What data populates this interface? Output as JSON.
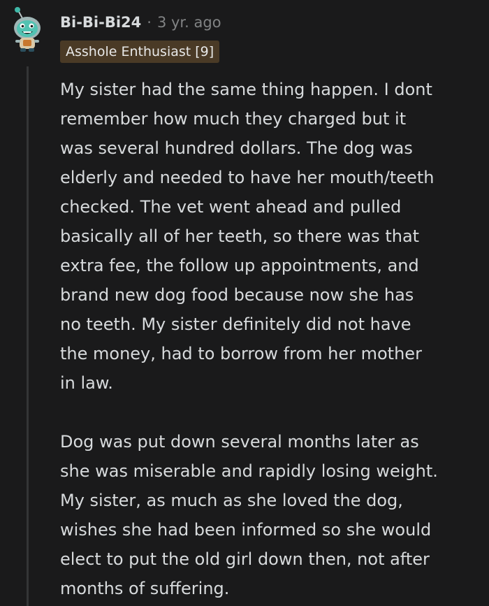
{
  "comment": {
    "author": "Bi-Bi-Bi24",
    "separator": "·",
    "timestamp": "3 yr. ago",
    "flair": "Asshole Enthusiast [9]",
    "avatar_icon": "snoo-avatar-icon",
    "paragraphs": [
      [
        "My sister had the same thing happen. I dont",
        "remember how much they charged but it",
        "was several hundred dollars. The dog was",
        "elderly and needed to have her mouth/teeth",
        "checked. The vet went ahead and pulled",
        "basically all of her teeth, so there was that",
        "extra fee, the follow up appointments, and",
        "brand new dog food because now she has",
        "no teeth. My sister definitely did not have",
        "the money, had to borrow from her mother",
        "in law."
      ],
      [
        "Dog was put down several months later as",
        "she was miserable and rapidly losing weight.",
        "My sister, as much as she loved the dog,",
        "wishes she had been informed so she would",
        "elect to put the old girl down then, not after",
        "months of suffering."
      ]
    ]
  },
  "colors": {
    "background": "#1a1a1b",
    "text": "#d7dadc",
    "meta": "#818384",
    "flair_bg": "#4a3a26",
    "thread_line": "#343536"
  }
}
